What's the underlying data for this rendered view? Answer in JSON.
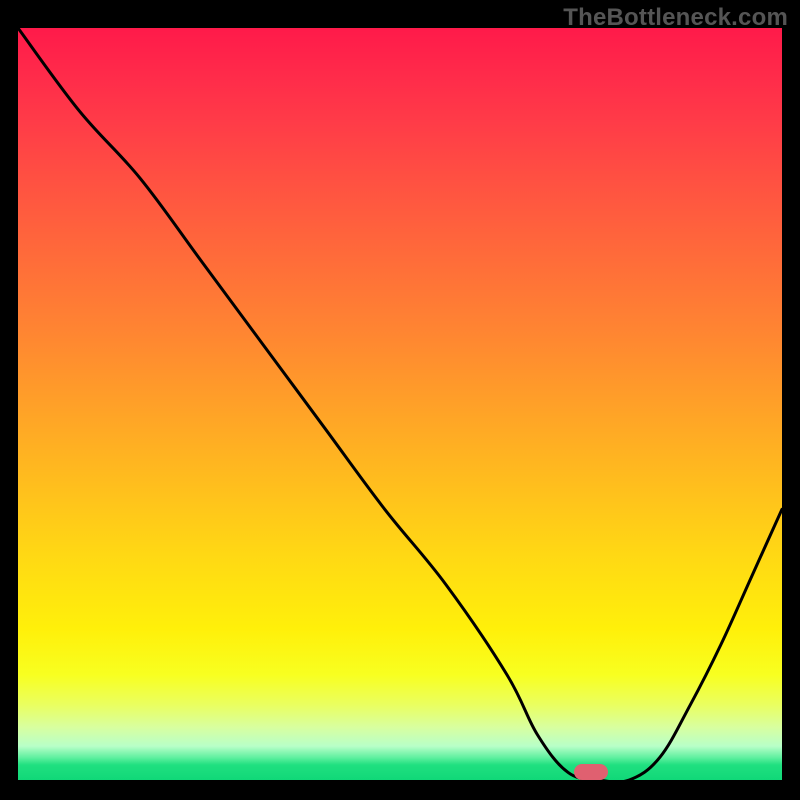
{
  "watermark_text": "TheBottleneck.com",
  "chart_data": {
    "type": "line",
    "title": "",
    "xlabel": "",
    "ylabel": "",
    "xlim": [
      0,
      100
    ],
    "ylim": [
      0,
      100
    ],
    "x": [
      0,
      8,
      16,
      24,
      32,
      40,
      48,
      56,
      64,
      68,
      72,
      76,
      80,
      84,
      88,
      92,
      96,
      100
    ],
    "values": [
      100,
      89,
      80,
      69,
      58,
      47,
      36,
      26,
      14,
      6,
      1,
      0,
      0,
      3,
      10,
      18,
      27,
      36
    ],
    "background_gradient": {
      "top": "#ff1a4a",
      "upper_mid": "#ff8432",
      "mid": "#ffd814",
      "lower_mid": "#f8ff20",
      "bottom": "#10d878"
    },
    "marker": {
      "x_percent": 75,
      "y_percent": 0
    },
    "annotations": []
  },
  "colors": {
    "frame": "#000000",
    "curve": "#000000",
    "watermark": "#555555",
    "marker": "#e06070"
  }
}
